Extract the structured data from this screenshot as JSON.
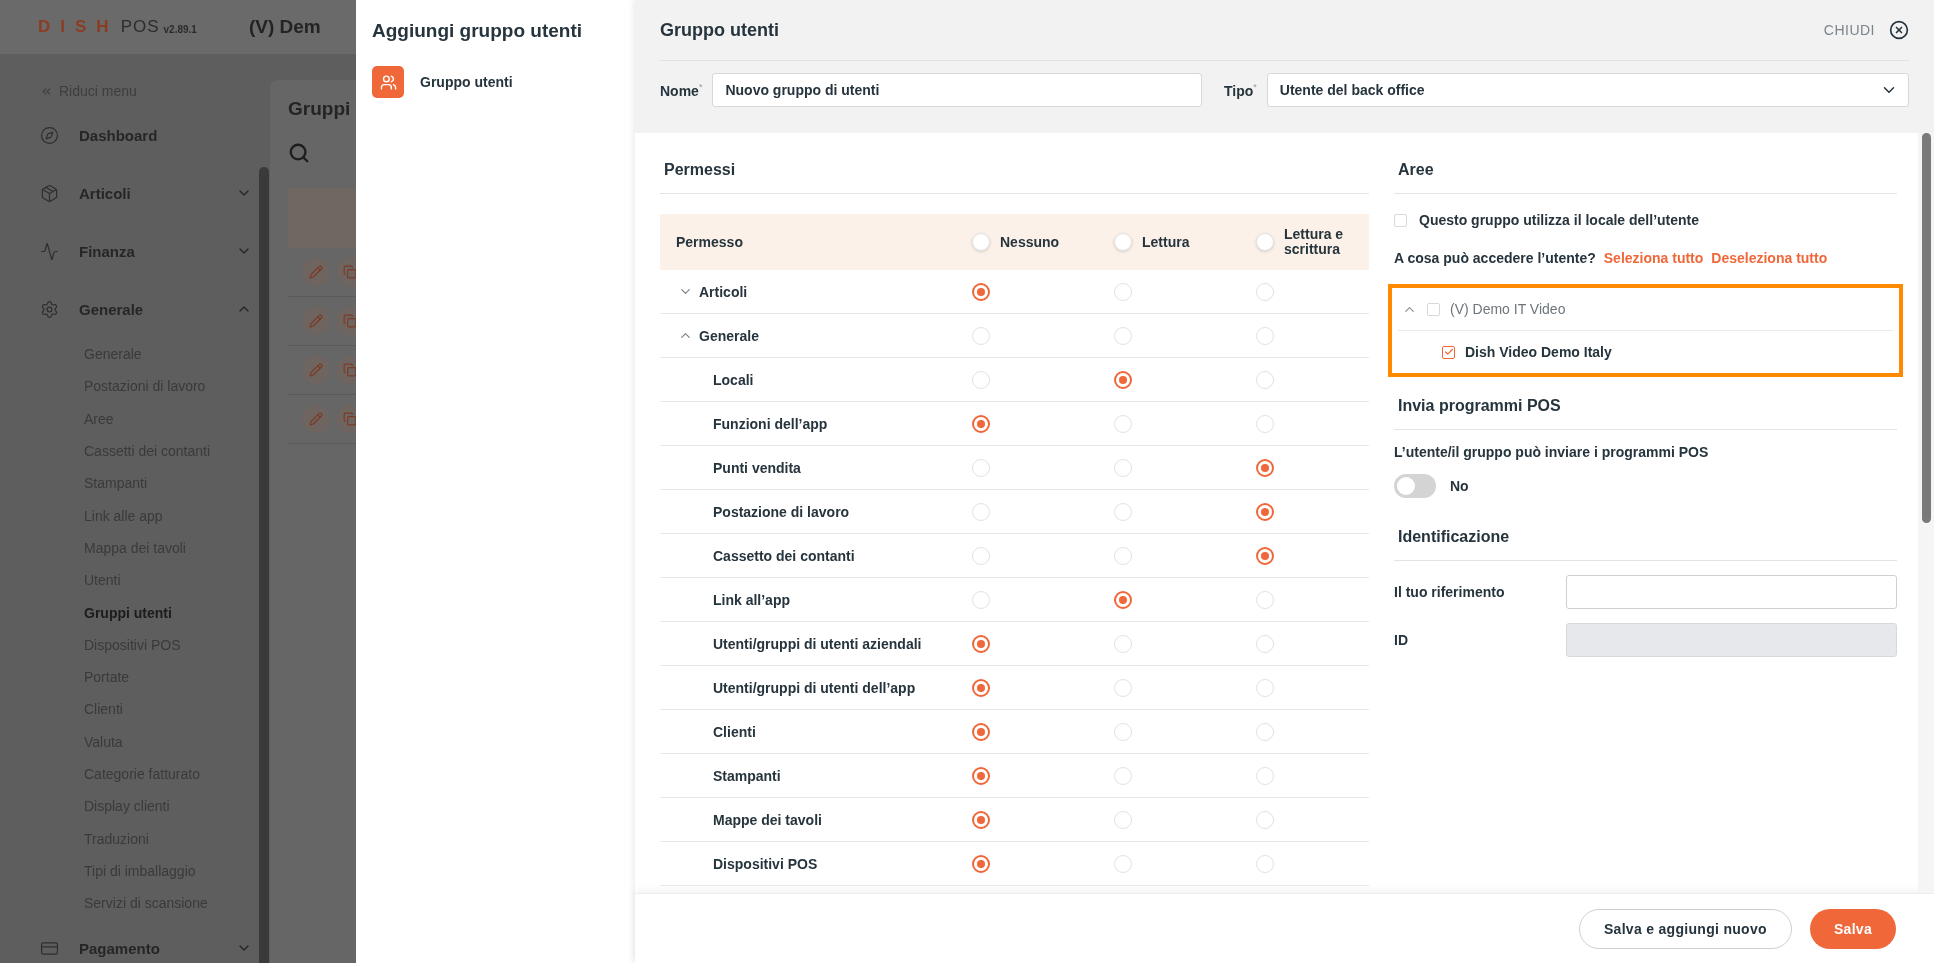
{
  "background_app": {
    "logo": "DISH",
    "product": "POS",
    "version": "v2.89.1",
    "venue": "(V) Dem",
    "collapse": "Riduci menu",
    "page_title": "Gruppi",
    "nav": [
      {
        "label": "Dashboard"
      },
      {
        "label": "Articoli",
        "expanded": false
      },
      {
        "label": "Finanza",
        "expanded": false
      },
      {
        "label": "Generale",
        "expanded": true,
        "children": [
          {
            "label": "Generale",
            "selected": false
          },
          {
            "label": "Postazioni di lavoro",
            "selected": false
          },
          {
            "label": "Aree",
            "selected": false
          },
          {
            "label": "Cassetti dei contanti",
            "selected": false
          },
          {
            "label": "Stampanti",
            "selected": false
          },
          {
            "label": "Link alle app",
            "selected": false
          },
          {
            "label": "Mappa dei tavoli",
            "selected": false
          },
          {
            "label": "Utenti",
            "selected": false
          },
          {
            "label": "Gruppi utenti",
            "selected": true
          },
          {
            "label": "Dispositivi POS",
            "selected": false
          },
          {
            "label": "Portate",
            "selected": false
          },
          {
            "label": "Clienti",
            "selected": false
          },
          {
            "label": "Valuta",
            "selected": false
          },
          {
            "label": "Categorie fatturato",
            "selected": false
          },
          {
            "label": "Display clienti",
            "selected": false
          },
          {
            "label": "Traduzioni",
            "selected": false
          },
          {
            "label": "Tipi di imballaggio",
            "selected": false
          },
          {
            "label": "Servizi di scansione",
            "selected": false
          }
        ]
      },
      {
        "label": "Pagamento",
        "expanded": false
      }
    ]
  },
  "wizard": {
    "title": "Aggiungi gruppo utenti",
    "steps": [
      {
        "label": "Gruppo utenti",
        "selected": true
      }
    ]
  },
  "panel": {
    "title": "Gruppo utenti",
    "close": "CHIUDI",
    "fields": [
      {
        "label": "Nome$^{*}$",
        "value": "Nuovo gruppo di utenti",
        "kind": "text"
      },
      {
        "label": "Tipo$^{*}$",
        "value": "Utente del back office",
        "kind": "select"
      }
    ]
  },
  "permissions": {
    "title": "Permessi",
    "first_column": "Permesso",
    "level_columns": [
      {
        "label": "Nessuno",
        "selected": false
      },
      {
        "label": "Lettura",
        "selected": false
      },
      {
        "label": "Lettura e scrittura",
        "selected": false
      }
    ],
    "rows": [
      {
        "label": "Articoli",
        "expanded": false,
        "options": [
          {
            "selected": true
          },
          {
            "selected": false
          },
          {
            "selected": false
          }
        ]
      },
      {
        "label": "Generale",
        "expanded": true,
        "options": [
          {
            "selected": false
          },
          {
            "selected": false
          },
          {
            "selected": false
          }
        ],
        "children": [
          {
            "label": "Locali",
            "options": [
              {
                "selected": false
              },
              {
                "selected": true
              },
              {
                "selected": false
              }
            ]
          },
          {
            "label": "Funzioni dell’app",
            "options": [
              {
                "selected": true
              },
              {
                "selected": false
              },
              {
                "selected": false
              }
            ]
          },
          {
            "label": "Punti vendita",
            "options": [
              {
                "selected": false
              },
              {
                "selected": false
              },
              {
                "selected": true
              }
            ]
          },
          {
            "label": "Postazione di lavoro",
            "options": [
              {
                "selected": false
              },
              {
                "selected": false
              },
              {
                "selected": true
              }
            ]
          },
          {
            "label": "Cassetto dei contanti",
            "options": [
              {
                "selected": false
              },
              {
                "selected": false
              },
              {
                "selected": true
              }
            ]
          },
          {
            "label": "Link all’app",
            "options": [
              {
                "selected": false
              },
              {
                "selected": true
              },
              {
                "selected": false
              }
            ]
          },
          {
            "label": "Utenti/gruppi di utenti aziendali",
            "options": [
              {
                "selected": true
              },
              {
                "selected": false
              },
              {
                "selected": false
              }
            ]
          },
          {
            "label": "Utenti/gruppi di utenti dell’app",
            "options": [
              {
                "selected": true
              },
              {
                "selected": false
              },
              {
                "selected": false
              }
            ]
          },
          {
            "label": "Clienti",
            "options": [
              {
                "selected": true
              },
              {
                "selected": false
              },
              {
                "selected": false
              }
            ]
          },
          {
            "label": "Stampanti",
            "options": [
              {
                "selected": true
              },
              {
                "selected": false
              },
              {
                "selected": false
              }
            ]
          },
          {
            "label": "Mappe dei tavoli",
            "options": [
              {
                "selected": true
              },
              {
                "selected": false
              },
              {
                "selected": false
              }
            ]
          },
          {
            "label": "Dispositivi POS",
            "options": [
              {
                "selected": true
              },
              {
                "selected": false
              },
              {
                "selected": false
              }
            ]
          }
        ]
      }
    ]
  },
  "areas": {
    "title": "Aree",
    "use_user_venue": {
      "label": "Questo gruppo utilizza il locale dell’utente",
      "checked": false
    },
    "question": "A cosa può accedere l’utente?",
    "select_all": "Seleziona tutto",
    "deselect_all": "Deseleziona tutto",
    "venues": {
      "highlighted": true,
      "items": [
        {
          "label": "(V) Demo IT Video",
          "checked": false,
          "expanded": true,
          "children": [
            {
              "label": "Dish Video Demo Italy",
              "checked": true
            }
          ]
        }
      ]
    }
  },
  "pos_programs": {
    "title": "Invia programmi POS",
    "label": "L’utente/il gruppo può inviare i programmi POS",
    "toggle": {
      "on": false,
      "label": "No"
    }
  },
  "identification": {
    "title": "Identificazione",
    "fields": [
      {
        "label": "Il tuo riferimento",
        "disabled": false
      },
      {
        "label": "ID",
        "disabled": true
      }
    ]
  },
  "footer": {
    "buttons": [
      {
        "label": "Salva e aggiungi nuovo",
        "kind": "secondary"
      },
      {
        "label": "Salva",
        "kind": "primary"
      }
    ]
  }
}
